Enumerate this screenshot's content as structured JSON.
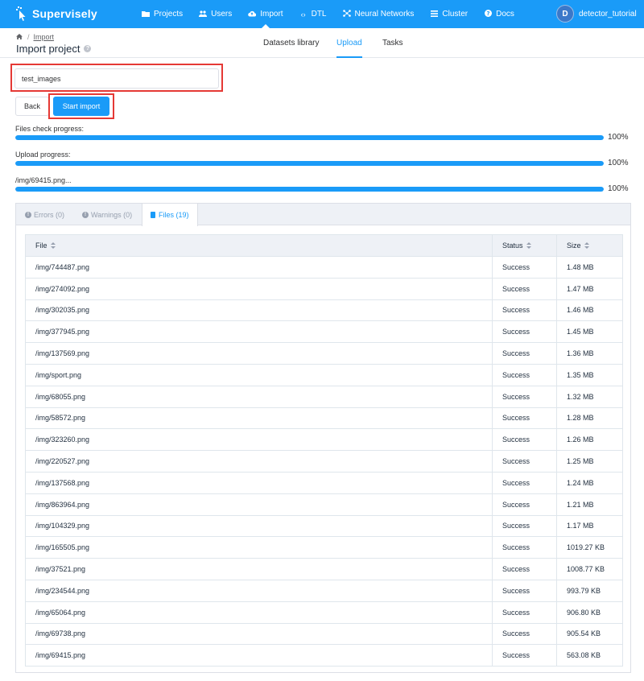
{
  "brand": {
    "name": "Supervisely",
    "accent": "#1a9bf8",
    "highlight": "#e53935"
  },
  "nav": [
    {
      "label": "Projects",
      "icon": "folder-icon"
    },
    {
      "label": "Users",
      "icon": "users-icon"
    },
    {
      "label": "Import",
      "icon": "cloud-upload-icon",
      "active": true
    },
    {
      "label": "DTL",
      "icon": "code-icon"
    },
    {
      "label": "Neural Networks",
      "icon": "network-icon"
    },
    {
      "label": "Cluster",
      "icon": "list-icon"
    },
    {
      "label": "Docs",
      "icon": "help-icon"
    }
  ],
  "user": {
    "initial": "D",
    "name": "detector_tutorial"
  },
  "breadcrumb": {
    "home_icon": "home-icon",
    "item": "Import"
  },
  "page": {
    "title": "Import project"
  },
  "tabs": {
    "library": "Datasets library",
    "upload": "Upload",
    "tasks": "Tasks",
    "active": "Upload"
  },
  "form": {
    "project_name": "test_images",
    "back_label": "Back",
    "start_label": "Start import"
  },
  "progress": [
    {
      "label": "Files check progress:",
      "value": 1.0,
      "pct_text": "100%"
    },
    {
      "label": "Upload progress:",
      "value": 1.0,
      "pct_text": "100%"
    },
    {
      "label": "/img/69415.png...",
      "value": 1.0,
      "pct_text": "100%"
    }
  ],
  "result_tabs": {
    "errors": "Errors (0)",
    "warnings": "Warnings (0)",
    "files": "Files (19)",
    "active": "files"
  },
  "table": {
    "headers": {
      "file": "File",
      "status": "Status",
      "size": "Size"
    },
    "rows": [
      {
        "file": "/img/744487.png",
        "status": "Success",
        "size": "1.48 MB"
      },
      {
        "file": "/img/274092.png",
        "status": "Success",
        "size": "1.47 MB"
      },
      {
        "file": "/img/302035.png",
        "status": "Success",
        "size": "1.46 MB"
      },
      {
        "file": "/img/377945.png",
        "status": "Success",
        "size": "1.45 MB"
      },
      {
        "file": "/img/137569.png",
        "status": "Success",
        "size": "1.36 MB"
      },
      {
        "file": "/img/sport.png",
        "status": "Success",
        "size": "1.35 MB"
      },
      {
        "file": "/img/68055.png",
        "status": "Success",
        "size": "1.32 MB"
      },
      {
        "file": "/img/58572.png",
        "status": "Success",
        "size": "1.28 MB"
      },
      {
        "file": "/img/323260.png",
        "status": "Success",
        "size": "1.26 MB"
      },
      {
        "file": "/img/220527.png",
        "status": "Success",
        "size": "1.25 MB"
      },
      {
        "file": "/img/137568.png",
        "status": "Success",
        "size": "1.24 MB"
      },
      {
        "file": "/img/863964.png",
        "status": "Success",
        "size": "1.21 MB"
      },
      {
        "file": "/img/104329.png",
        "status": "Success",
        "size": "1.17 MB"
      },
      {
        "file": "/img/165505.png",
        "status": "Success",
        "size": "1019.27 KB"
      },
      {
        "file": "/img/37521.png",
        "status": "Success",
        "size": "1008.77 KB"
      },
      {
        "file": "/img/234544.png",
        "status": "Success",
        "size": "993.79 KB"
      },
      {
        "file": "/img/65064.png",
        "status": "Success",
        "size": "906.80 KB"
      },
      {
        "file": "/img/69738.png",
        "status": "Success",
        "size": "905.54 KB"
      },
      {
        "file": "/img/69415.png",
        "status": "Success",
        "size": "563.08 KB"
      }
    ]
  }
}
